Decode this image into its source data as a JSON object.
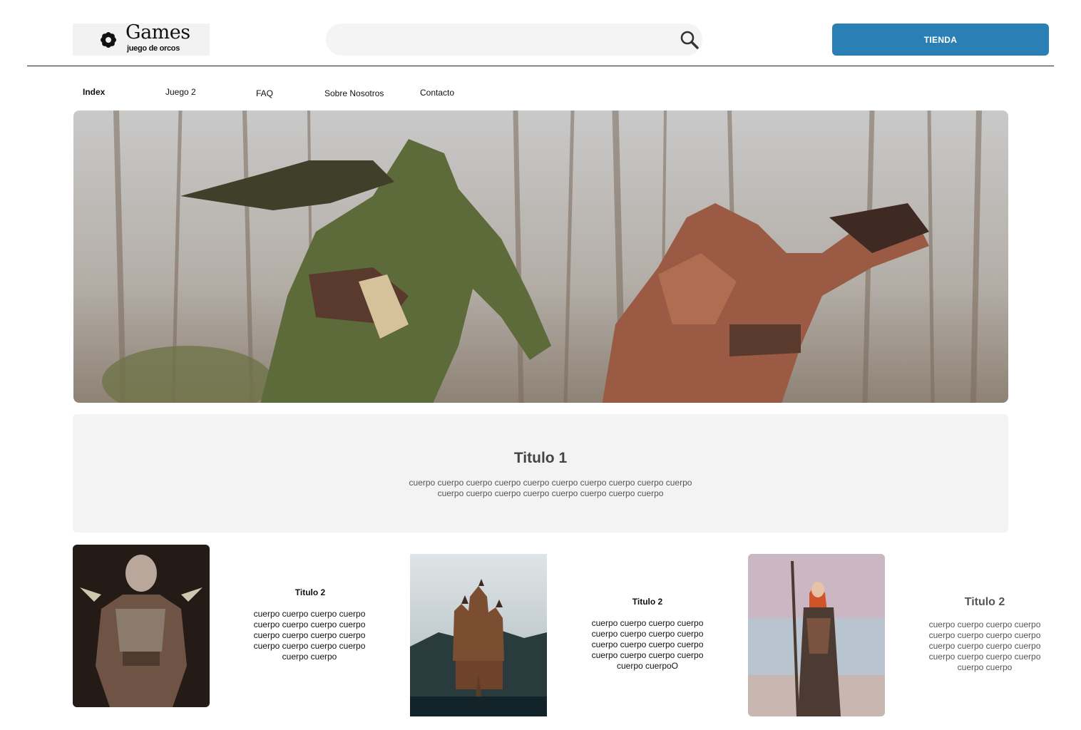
{
  "header": {
    "logo_title": "Games",
    "logo_subtitle": "juego de orcos",
    "search_placeholder": "",
    "store_button": "TIENDA"
  },
  "nav": {
    "items": [
      {
        "label": "Index",
        "active": true
      },
      {
        "label": "Juego  2",
        "active": false
      },
      {
        "label": "FAQ",
        "active": false
      },
      {
        "label": "Sobre Nosotros",
        "active": false
      },
      {
        "label": "Contacto",
        "active": false
      }
    ]
  },
  "intro": {
    "title": "Titulo 1",
    "body": "cuerpo cuerpo cuerpo cuerpo cuerpo cuerpo  cuerpo cuerpo cuerpo cuerpo cuerpo cuerpo cuerpo cuerpo cuerpo cuerpo cuerpo cuerpo"
  },
  "cards": [
    {
      "title": "Titulo 2",
      "body": "cuerpo cuerpo cuerpo cuerpo cuerpo cuerpo  cuerpo cuerpo cuerpo cuerpo cuerpo cuerpo cuerpo cuerpo cuerpo cuerpo cuerpo cuerpo"
    },
    {
      "title": "Titulo 2",
      "body": "cuerpo cuerpo cuerpo cuerpo cuerpo cuerpo  cuerpo cuerpo cuerpo cuerpo cuerpo cuerpo cuerpo cuerpo cuerpo cuerpo cuerpo cuerpoO"
    },
    {
      "title": "Titulo 2",
      "body": "cuerpo cuerpo cuerpo cuerpo cuerpo cuerpo  cuerpo cuerpo cuerpo cuerpo cuerpo cuerpo cuerpo cuerpo cuerpo cuerpo cuerpo cuerpo"
    }
  ],
  "colors": {
    "accent": "#2a7fb5",
    "panel": "#f3f3f3"
  }
}
